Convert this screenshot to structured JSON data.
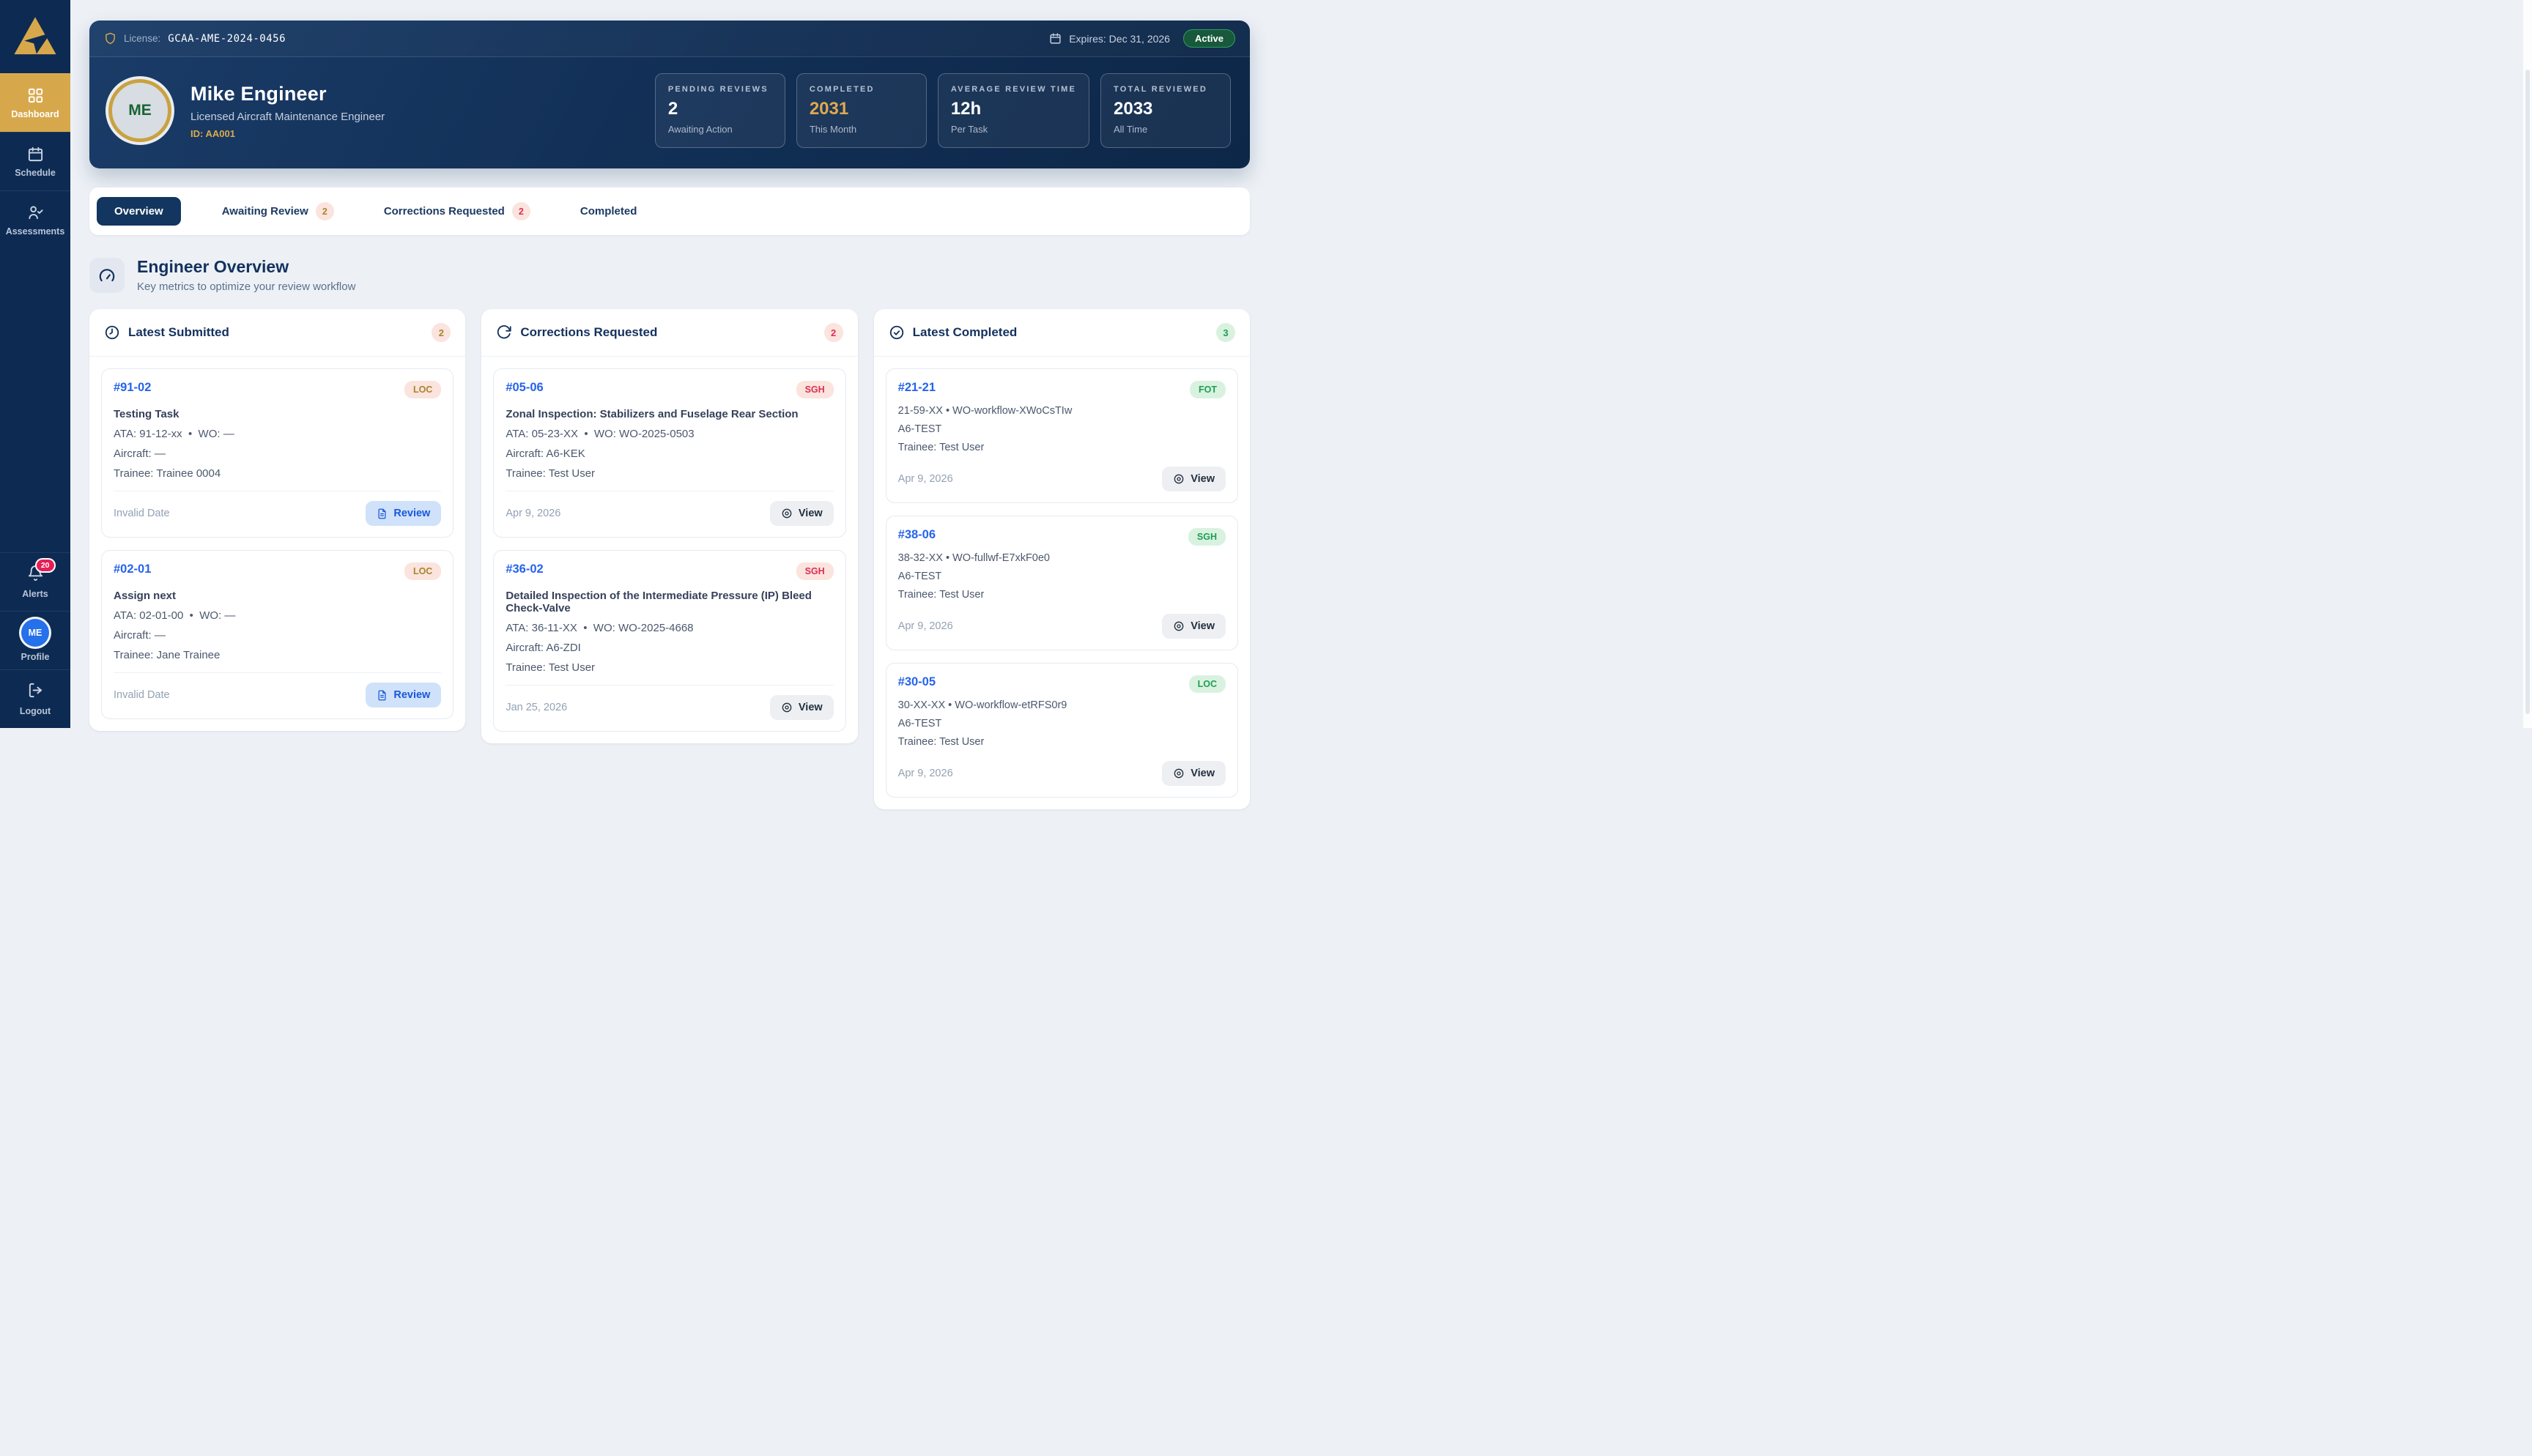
{
  "sidebar": {
    "items": [
      {
        "label": "Dashboard",
        "icon": "grid",
        "active": true
      },
      {
        "label": "Schedule",
        "icon": "calendar",
        "active": false
      },
      {
        "label": "Assessments",
        "icon": "user-check",
        "active": false
      }
    ],
    "alerts_label": "Alerts",
    "alerts_badge": "20",
    "profile_label": "Profile",
    "profile_initials": "ME",
    "logout_label": "Logout"
  },
  "hero": {
    "license_label": "License:",
    "license_value": "GCAA-AME-2024-0456",
    "expires_text": "Expires: Dec 31, 2026",
    "status_badge": "Active",
    "avatar_initials": "ME",
    "name": "Mike Engineer",
    "role": "Licensed Aircraft Maintenance Engineer",
    "engineer_id": "ID: AA001",
    "stats": [
      {
        "label": "PENDING REVIEWS",
        "value": "2",
        "sub": "Awaiting Action",
        "accent": "white"
      },
      {
        "label": "COMPLETED",
        "value": "2031",
        "sub": "This Month",
        "accent": "gold"
      },
      {
        "label": "AVERAGE REVIEW TIME",
        "value": "12h",
        "sub": "Per Task",
        "accent": "white"
      },
      {
        "label": "TOTAL REVIEWED",
        "value": "2033",
        "sub": "All Time",
        "accent": "white"
      }
    ]
  },
  "tabs": [
    {
      "label": "Overview",
      "active": true
    },
    {
      "label": "Awaiting Review",
      "badge": "2",
      "badge_style": "gold"
    },
    {
      "label": "Corrections Requested",
      "badge": "2",
      "badge_style": "red"
    },
    {
      "label": "Completed"
    }
  ],
  "section": {
    "title": "Engineer Overview",
    "subtitle": "Key metrics to optimize your review workflow"
  },
  "columns": [
    {
      "title": "Latest Submitted",
      "icon": "clock",
      "count": "2",
      "count_style": "pink-gold",
      "cards": [
        {
          "id": "#91-02",
          "tag": "LOC",
          "tag_style": "pink-gold",
          "title": "Testing Task",
          "lines": [
            "ATA: 91-12-xx  •  WO: —",
            "Aircraft: —",
            "Trainee: Trainee 0004"
          ],
          "date": "Invalid Date",
          "action": "Review",
          "action_style": "review",
          "divider": true
        },
        {
          "id": "#02-01",
          "tag": "LOC",
          "tag_style": "pink-gold",
          "title": "Assign next",
          "lines": [
            "ATA: 02-01-00  •  WO: —",
            "Aircraft: —",
            "Trainee: Jane Trainee"
          ],
          "date": "Invalid Date",
          "action": "Review",
          "action_style": "review",
          "divider": true
        }
      ]
    },
    {
      "title": "Corrections Requested",
      "icon": "refresh",
      "count": "2",
      "count_style": "pink-red",
      "cards": [
        {
          "id": "#05-06",
          "tag": "SGH",
          "tag_style": "pink-red",
          "title": "Zonal Inspection: Stabilizers and Fuselage Rear Section",
          "lines": [
            "ATA: 05-23-XX  •  WO: WO-2025-0503",
            "Aircraft: A6-KEK",
            "Trainee: Test User"
          ],
          "date": "Apr 9, 2026",
          "action": "View",
          "action_style": "view",
          "divider": true
        },
        {
          "id": "#36-02",
          "tag": "SGH",
          "tag_style": "pink-red",
          "title": "Detailed Inspection of the Intermediate Pressure (IP) Bleed Check-Valve",
          "lines": [
            "ATA: 36-11-XX  •  WO: WO-2025-4668",
            "Aircraft: A6-ZDI",
            "Trainee: Test User"
          ],
          "date": "Jan 25, 2026",
          "action": "View",
          "action_style": "view",
          "divider": true
        }
      ]
    },
    {
      "title": "Latest Completed",
      "icon": "check-circle",
      "count": "3",
      "count_style": "green",
      "cards": [
        {
          "id": "#21-21",
          "tag": "FOT",
          "tag_style": "green",
          "lines": [
            "21-59-XX • WO-workflow-XWoCsTIw",
            "A6-TEST",
            "Trainee: Test User"
          ],
          "date": "Apr 9, 2026",
          "action": "View",
          "action_style": "view",
          "divider": false
        },
        {
          "id": "#38-06",
          "tag": "SGH",
          "tag_style": "green",
          "lines": [
            "38-32-XX • WO-fullwf-E7xkF0e0",
            "A6-TEST",
            "Trainee: Test User"
          ],
          "date": "Apr 9, 2026",
          "action": "View",
          "action_style": "view",
          "divider": false
        },
        {
          "id": "#30-05",
          "tag": "LOC",
          "tag_style": "green",
          "lines": [
            "30-XX-XX • WO-workflow-etRFS0r9",
            "A6-TEST",
            "Trainee: Test User"
          ],
          "date": "Apr 9, 2026",
          "action": "View",
          "action_style": "view",
          "divider": false
        }
      ]
    }
  ],
  "colors": {
    "sidebar_navy": "#0d2b52",
    "accent_gold": "#d7a84b",
    "link_blue": "#2563eb",
    "badge_pink_bg": "#fbe3de",
    "badge_gold_text": "#a9852d",
    "badge_red_text": "#dc2f55",
    "badge_green_bg": "#d9f2e0",
    "badge_green_text": "#1f9d55",
    "active_pill_green": "#2f9e62"
  }
}
